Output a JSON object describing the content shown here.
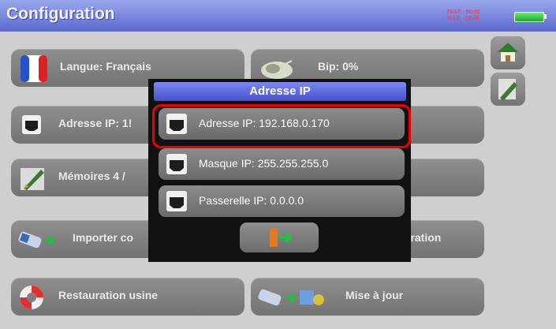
{
  "header": {
    "title": "Configuration",
    "status_line1": "FAST: -60dB",
    "status_line2": "MAX: -36dB"
  },
  "menu": {
    "language_label": "Langue: Français",
    "bip_label": "Bip: 0%",
    "ip_label": "Adresse IP: 1!",
    "memories_label": "Mémoires 4 /",
    "import_label": "Importer co",
    "export_label": "juration",
    "factory_label": "Restauration usine",
    "update_label": "Mise à jour"
  },
  "popup": {
    "title": "Adresse IP",
    "ip_address": "Adresse IP: 192.168.0.170",
    "ip_mask": "Masque IP: 255.255.255.0",
    "gateway": "Passerelle IP: 0.0.0.0"
  },
  "icons": {
    "home": "home-icon",
    "edit": "edit-icon",
    "network": "ethernet-port-icon",
    "back": "exit-door-icon",
    "flag": "french-flag-icon",
    "speaker": "speaker-icon",
    "usb": "usb-key-icon",
    "lifebuoy": "lifebuoy-icon"
  },
  "colors": {
    "titlebar": "#5a68cc",
    "highlight": "#ee0000",
    "battery": "#1fa82c",
    "button": "#7f7f7f"
  }
}
